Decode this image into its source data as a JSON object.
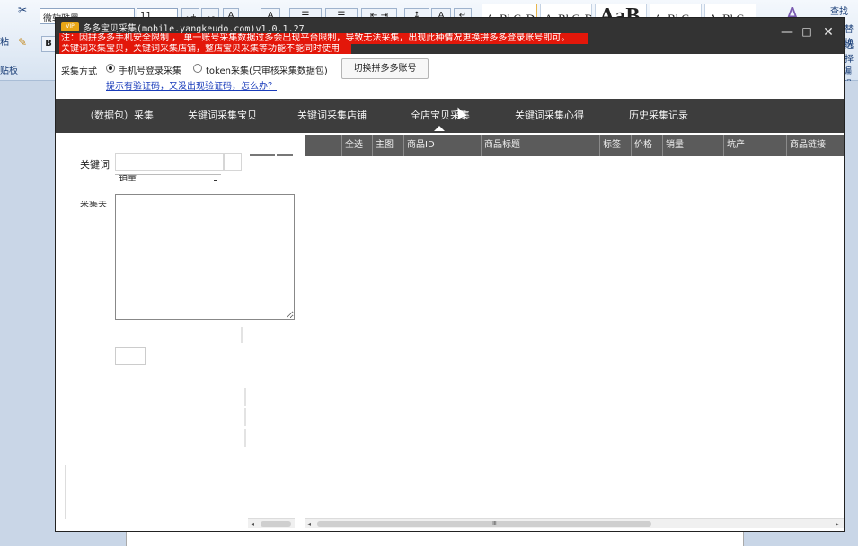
{
  "background": {
    "font_name": "微软雅黑",
    "font_size": "11",
    "style_samples": [
      "AaBbCcD",
      "AaBbCcD",
      "AaB",
      "AaBbC",
      "AaBbC"
    ],
    "right_labels": [
      "查找",
      "替换",
      "选择",
      "编辑"
    ],
    "left_labels": [
      "粘",
      "贴板"
    ]
  },
  "window": {
    "badge": "VIP",
    "title": "多多宝贝采集(mobile.yangkeudo.com)v1.0.1.27",
    "notice_line1": "注：因拼多多手机安全限制 ， 单一账号采集数据过多会出现平台限制，导致无法采集，出现此种情况更换拼多多登录账号即可。",
    "notice_line2": "关键词采集宝贝，关键词采集店铺，整店宝贝采集等功能不能同时使用",
    "controls": {
      "minimize": "—",
      "maximize": "□",
      "close": "✕"
    }
  },
  "mode": {
    "label": "采集方式",
    "option_phone": "手机号登录采集",
    "option_token": "token采集(只审核采集数据包)",
    "switch_button": "切换拼多多账号",
    "help_link": "提示有验证码，又没出现验证码，怎么办？"
  },
  "tabs": [
    {
      "label": "（数据包）采集"
    },
    {
      "label": "关键词采集宝贝"
    },
    {
      "label": "关键词采集店铺"
    },
    {
      "label": "全店宝贝采集"
    },
    {
      "label": "关键词采集心得"
    },
    {
      "label": "历史采集记录"
    }
  ],
  "left_panel": {
    "keyword_label": "关键词",
    "keyword_value": "",
    "sort_value": "销量",
    "collected_label": "采集关"
  },
  "grid": {
    "columns": [
      "全选",
      "主图",
      "商品ID",
      "商品标题",
      "标签",
      "价格",
      "销量",
      "坑产",
      "商品链接"
    ]
  },
  "scrollbar": {
    "grip": "Ⅲ"
  }
}
